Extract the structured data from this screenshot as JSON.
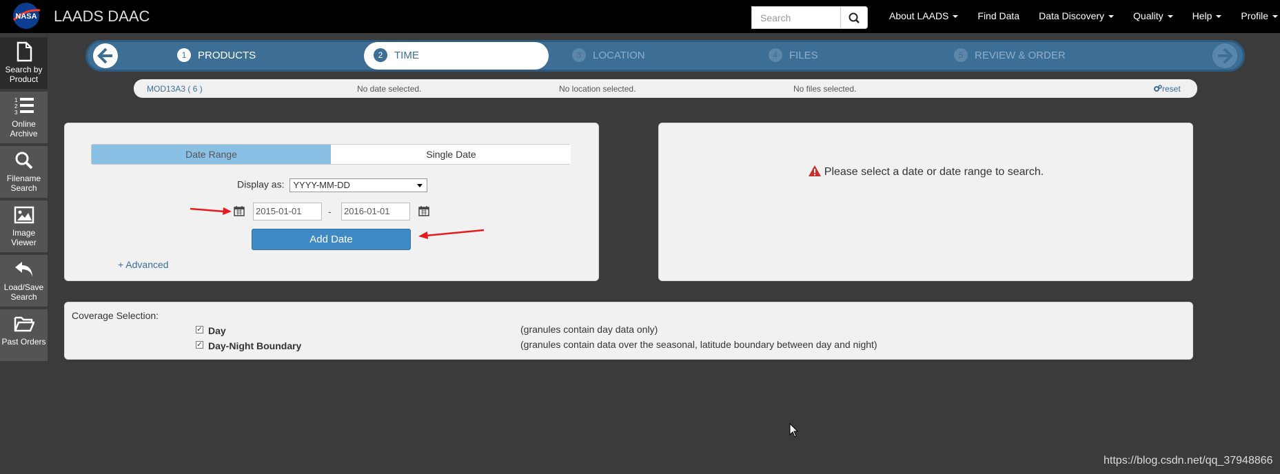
{
  "header": {
    "brand": "LAADS DAAC",
    "search_placeholder": "Search",
    "nav": [
      {
        "label": "About LAADS",
        "dropdown": true
      },
      {
        "label": "Find Data",
        "dropdown": false
      },
      {
        "label": "Data Discovery",
        "dropdown": true
      },
      {
        "label": "Quality",
        "dropdown": true
      },
      {
        "label": "Help",
        "dropdown": true
      },
      {
        "label": "Profile",
        "dropdown": true
      }
    ]
  },
  "sidebar": {
    "items": [
      {
        "label": "Search by Product",
        "icon": "document-icon",
        "active": true
      },
      {
        "label": "Online Archive",
        "icon": "list-icon",
        "active": false
      },
      {
        "label": "Filename Search",
        "icon": "search-icon",
        "active": false
      },
      {
        "label": "Image Viewer",
        "icon": "image-icon",
        "active": false
      },
      {
        "label": "Load/Save Search",
        "icon": "undo-icon",
        "active": false
      },
      {
        "label": "Past Orders",
        "icon": "folder-icon",
        "active": false
      }
    ]
  },
  "wizard": {
    "steps": [
      {
        "num": "1",
        "label": "PRODUCTS",
        "state": "done"
      },
      {
        "num": "2",
        "label": "TIME",
        "state": "active"
      },
      {
        "num": "3",
        "label": "LOCATION",
        "state": "pending"
      },
      {
        "num": "4",
        "label": "FILES",
        "state": "pending"
      },
      {
        "num": "5",
        "label": "REVIEW & ORDER",
        "state": "pending"
      }
    ]
  },
  "summary": {
    "product": "MOD13A3 ( 6 )",
    "date": "No date selected.",
    "location": "No location selected.",
    "files": "No files selected.",
    "reset": "reset"
  },
  "time_panel": {
    "tabs": [
      "Date Range",
      "Single Date"
    ],
    "active_tab": "Date Range",
    "display_as_label": "Display as:",
    "display_format": "YYYY-MM-DD",
    "start_date": "2015-01-01",
    "end_date": "2016-01-01",
    "separator": "-",
    "add_button": "Add Date",
    "advanced_link": "+ Advanced"
  },
  "results_panel": {
    "message": "Please select a date or date range to search."
  },
  "coverage": {
    "title": "Coverage Selection:",
    "options": [
      {
        "label": "Day",
        "checked": true,
        "description": "(granules contain day data only)"
      },
      {
        "label": "Day-Night Boundary",
        "checked": true,
        "description": "(granules contain data over the seasonal, latitude boundary between day and night)"
      }
    ]
  },
  "watermark": "https://blog.csdn.net/qq_37948866",
  "colors": {
    "accent": "#3c6e96",
    "button": "#3f8ac5",
    "active_tab": "#8ac0e3",
    "annotation_arrow": "#e8191c"
  }
}
